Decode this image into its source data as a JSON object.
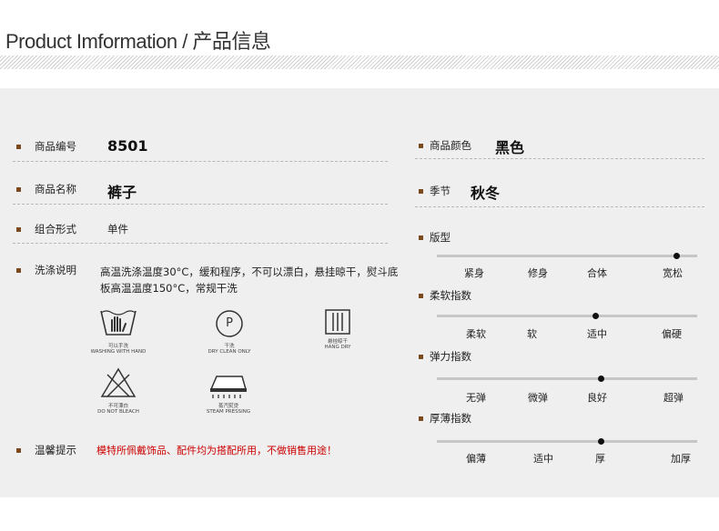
{
  "header": {
    "title": "Product Imformation / 产品信息"
  },
  "left": {
    "code_label": "商品编号",
    "code_value": "8501",
    "name_label": "商品名称",
    "name_value": "裤子",
    "combo_label": "组合形式",
    "combo_value": "单件",
    "wash_label": "洗涤说明",
    "wash_text": "高温洗涤温度30°C，缓和程序，不可以漂白，悬挂晾干，熨斗底板高温温度150°C，常规干洗",
    "icons": {
      "hand_wash_cn": "可以手洗",
      "hand_wash_en": "WASHING WITH HAND",
      "dry_clean_letter": "P",
      "dry_clean_cn": "干洗",
      "dry_clean_en": "DRY CLEAN ONLY",
      "hang_dry_cn": "悬挂晾干",
      "hang_dry_en": "HANG DRY",
      "no_bleach_cn": "不可漂白",
      "no_bleach_en": "DO NOT BLEACH",
      "steam_cn": "蒸汽熨烫",
      "steam_en": "STEAM PRESSING"
    },
    "tip_label": "温馨提示",
    "tip_text": "模特所佩戴饰品、配件均为搭配所用，不做销售用途！"
  },
  "right": {
    "color_label": "商品颜色",
    "color_value": "黑色",
    "season_label": "季节",
    "season_value": "秋冬",
    "scales": [
      {
        "label": "版型",
        "options": [
          "紧身",
          "修身",
          "合体",
          "宽松"
        ],
        "selected_fraction": 0.92
      },
      {
        "label": "柔软指数",
        "options": [
          "柔软",
          "软",
          "适中",
          "偏硬"
        ],
        "selected_fraction": 0.61
      },
      {
        "label": "弹力指数",
        "options": [
          "无弹",
          "微弹",
          "良好",
          "超弹"
        ],
        "selected_fraction": 0.63
      },
      {
        "label": "厚薄指数",
        "options": [
          "偏薄",
          "适中",
          "厚",
          "加厚"
        ],
        "selected_fraction": 0.63
      }
    ]
  },
  "colors": {
    "bullet": "#7a4a1e",
    "warning": "#cc0000",
    "panel": "#efefef"
  }
}
